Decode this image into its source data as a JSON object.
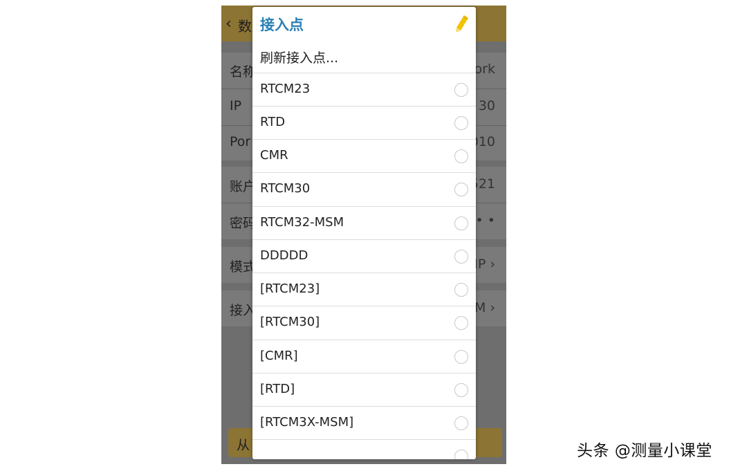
{
  "background": {
    "title": "数",
    "rows": [
      {
        "label": "名称",
        "value": "ork"
      },
      {
        "label": "IP",
        "value": "30"
      },
      {
        "label": "Por",
        "value": "010"
      },
      {
        "label": "账户",
        "value": "521"
      },
      {
        "label": "密码",
        "value": "• •"
      },
      {
        "label": "模式",
        "value": "IP ›"
      },
      {
        "label": "接入",
        "value": "M ›"
      }
    ],
    "bottom_button": "从"
  },
  "dialog": {
    "title": "接入点",
    "refresh_label": "刷新接入点...",
    "options": [
      {
        "label": "RTCM23",
        "selected": false
      },
      {
        "label": "RTD",
        "selected": false
      },
      {
        "label": "CMR",
        "selected": false
      },
      {
        "label": "RTCM30",
        "selected": false
      },
      {
        "label": "RTCM32-MSM",
        "selected": false
      },
      {
        "label": "DDDDD",
        "selected": false
      },
      {
        "label": "[RTCM23]",
        "selected": false
      },
      {
        "label": "[RTCM30]",
        "selected": false
      },
      {
        "label": "[CMR]",
        "selected": false
      },
      {
        "label": "[RTD]",
        "selected": false
      },
      {
        "label": "[RTCM3X-MSM]",
        "selected": false
      },
      {
        "label": "",
        "selected": false
      }
    ],
    "pencil_icon": "pencil-icon"
  },
  "watermark": "头条 @测量小课堂",
  "colors": {
    "title_blue": "#2a7fb4",
    "appbar_gold": "#8c7434",
    "pencil_yellow": "#f2c200"
  }
}
